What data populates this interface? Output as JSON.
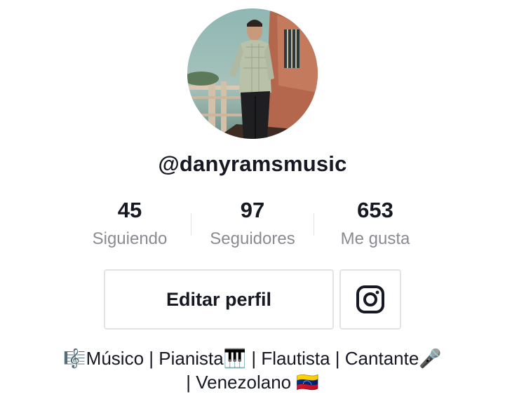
{
  "profile": {
    "username": "@danyramsmusic",
    "avatar_alt": "profile photo"
  },
  "stats": [
    {
      "value": "45",
      "label": "Siguiendo"
    },
    {
      "value": "97",
      "label": "Seguidores"
    },
    {
      "value": "653",
      "label": "Me gusta"
    }
  ],
  "actions": {
    "edit_label": "Editar perfil",
    "instagram_icon": "instagram-icon"
  },
  "bio": {
    "line1": "🎼Músico | Pianista🎹 | Flautista | Cantante🎤",
    "line2": "| Venezolano 🇻🇪"
  },
  "colors": {
    "text_primary": "#161823",
    "text_secondary": "#8a8b91",
    "border": "#e3e3e4"
  }
}
